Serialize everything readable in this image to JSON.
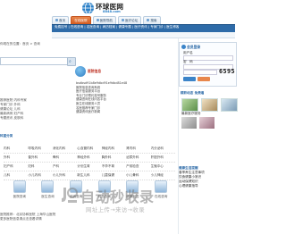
{
  "header": {
    "logo_text": "环球医网",
    "logo_domain": "8848.com",
    "tabs": [
      "首页",
      "在线医院",
      "医院导航",
      "医疗论坛",
      "搜索"
    ],
    "active_tab": 1
  },
  "navbar": {
    "links": "免费挂号 | 在线咨询 | 名医查询 | 病历档案 | 健康专题 | 医疗资讯 | 专家门诊 | 医生博客"
  },
  "left": {
    "breadcrumb": "你现在的位置：首页 > 查询",
    "items": [
      "推荐医院 内科专家",
      "专家门诊 外科",
      "健康论坛 儿科",
      "最新病例 妇产科",
      "专题资讯 皮肤科"
    ]
  },
  "doc": {
    "title": "医院信息",
    "lines": [
      "bsdbsd91b8e9dbd91e9dbd81e48",
      "医院信息查询系统",
      "医疗信息服务平台",
      "专业门诊预约挂号服务",
      "健康咨询在线问答平台",
      "医生在线服务人员",
      "名医推荐专家门诊",
      "健康资讯医疗新闻"
    ]
  },
  "login": {
    "title": "会员登录",
    "username_label": "用户名",
    "password_label": "密　码",
    "captcha": "6595"
  },
  "news": {
    "title": "精彩动态 免费看",
    "caption": "最新医疗服务"
  },
  "tips": {
    "title": "健康生活提醒",
    "lines": [
      "春季养生注意事项",
      "饮食健康小常识",
      "运动保健知识",
      "心理健康指导"
    ]
  },
  "table": {
    "title": "科室分类",
    "rows": [
      [
        "内科",
        "呼吸内科",
        "消化内科",
        "心血管内科",
        "神经内科",
        "肾内科",
        "内分泌科"
      ],
      [
        "外科",
        "普外科",
        "骨科",
        "神经外科",
        "胸外科",
        "泌尿外科",
        "肝胆外科"
      ],
      [
        "妇产科",
        "妇科",
        "产科",
        "计划生育",
        "不孕不育",
        "产前检查",
        "生殖中心"
      ],
      [
        "儿科",
        "小儿内科",
        "小儿外科",
        "新生儿科",
        "儿童保健",
        "小儿骨科",
        "小儿神经"
      ]
    ]
  },
  "icons": [
    {
      "label": "医院查询"
    },
    {
      "label": "医生查询"
    },
    {
      "label": "疾病查询"
    },
    {
      "label": "药品查询"
    },
    {
      "label": "健康问答"
    },
    {
      "label": "在线咨询"
    }
  ],
  "bottom": {
    "lines": [
      "医院推荐：北京协和医院 上海华山医院",
      "更多医院信息请点击查看详情"
    ]
  },
  "watermark": {
    "big": "自动秒收录",
    "small": "网址上传→来访→收录"
  }
}
